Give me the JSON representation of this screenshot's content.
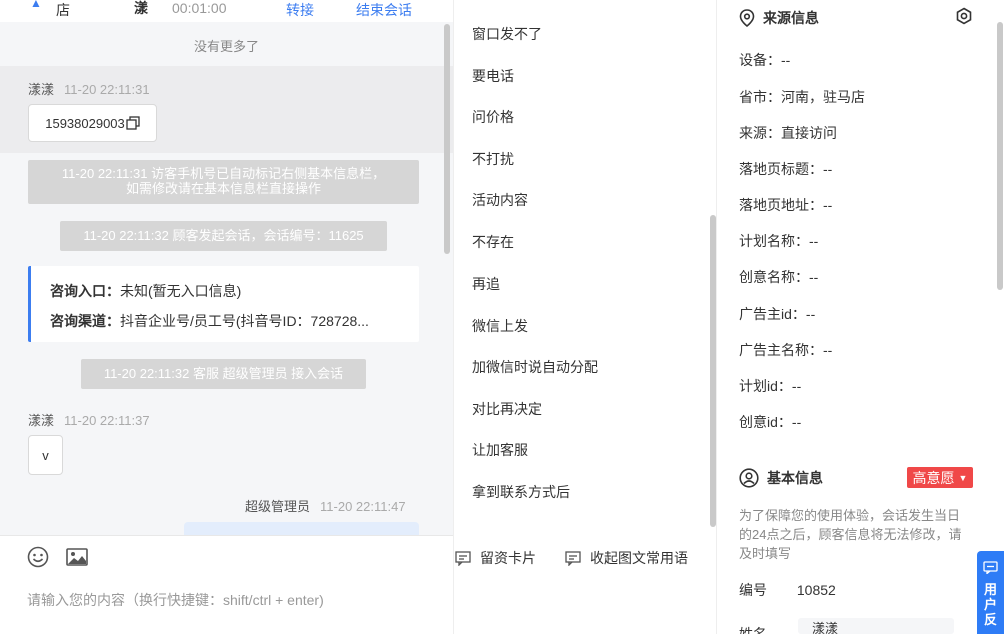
{
  "header": {
    "store_fragment": "店",
    "visitor_fragment": "漾",
    "timer": "00:01:00",
    "transfer_label": "转接",
    "end_label": "结束会话"
  },
  "chat": {
    "no_more": "没有更多了",
    "messages": [
      {
        "sender": "漾漾",
        "time": "11-20 22:11:31",
        "content": "15938029003"
      },
      {
        "sender": "漾漾",
        "time": "11-20 22:11:37",
        "content": "v"
      }
    ],
    "system": {
      "phone_marked_line1": "11-20 22:11:31 访客手机号已自动标记右侧基本信息栏，",
      "phone_marked_line2": "如需修改请在基本信息栏直接操作",
      "session_started": "11-20 22:11:32 顾客发起会话，会话编号：11625",
      "agent_joined": "11-20 22:11:32 客服 超级管理员 接入会话"
    },
    "consult_card": {
      "entry_label": "咨询入口：",
      "entry_value": "未知(暂无入口信息)",
      "channel_label": "咨询渠道：",
      "channel_value": "抖音企业号/员工号(抖音号ID：728728..."
    },
    "agent": {
      "name": "超级管理员",
      "time": "11-20 22:11:47"
    },
    "input_placeholder": "请输入您的内容（换行快捷键：shift/ctrl + enter)"
  },
  "phrases": {
    "items": [
      "窗口发不了",
      "要电话",
      "问价格",
      "不打扰",
      "活动内容",
      "不存在",
      "再追",
      "微信上发",
      "加微信时说自动分配",
      "对比再决定",
      "让加客服",
      "拿到联系方式后"
    ],
    "card_button": "留资卡片",
    "collapse_button": "收起图文常用语"
  },
  "info": {
    "source_title": "来源信息",
    "source_fields": [
      {
        "label": "设备：",
        "value": "--"
      },
      {
        "label": "省市：",
        "value": "河南，驻马店"
      },
      {
        "label": "来源：",
        "value": "直接访问"
      },
      {
        "label": "落地页标题：",
        "value": "--"
      },
      {
        "label": "落地页地址：",
        "value": "--"
      },
      {
        "label": "计划名称：",
        "value": "--"
      },
      {
        "label": "创意名称：",
        "value": "--"
      },
      {
        "label": "广告主id：",
        "value": "--"
      },
      {
        "label": "广告主名称：",
        "value": "--"
      },
      {
        "label": "计划id：",
        "value": "--"
      },
      {
        "label": "创意id：",
        "value": "--"
      }
    ],
    "basic_title": "基本信息",
    "intent_badge": "高意愿",
    "note": "为了保障您的使用体验，会话发生当日的24点之后，顾客信息将无法修改，请及时填写",
    "number_label": "编号",
    "number_value": "10852",
    "name_label": "姓名",
    "name_value": "漾漾"
  },
  "float_tab": {
    "line1": "用",
    "line2": "户",
    "line3": "反"
  },
  "colors": {
    "accent": "#2e7cf6",
    "badge": "#f04848",
    "link": "#3c7df0"
  }
}
